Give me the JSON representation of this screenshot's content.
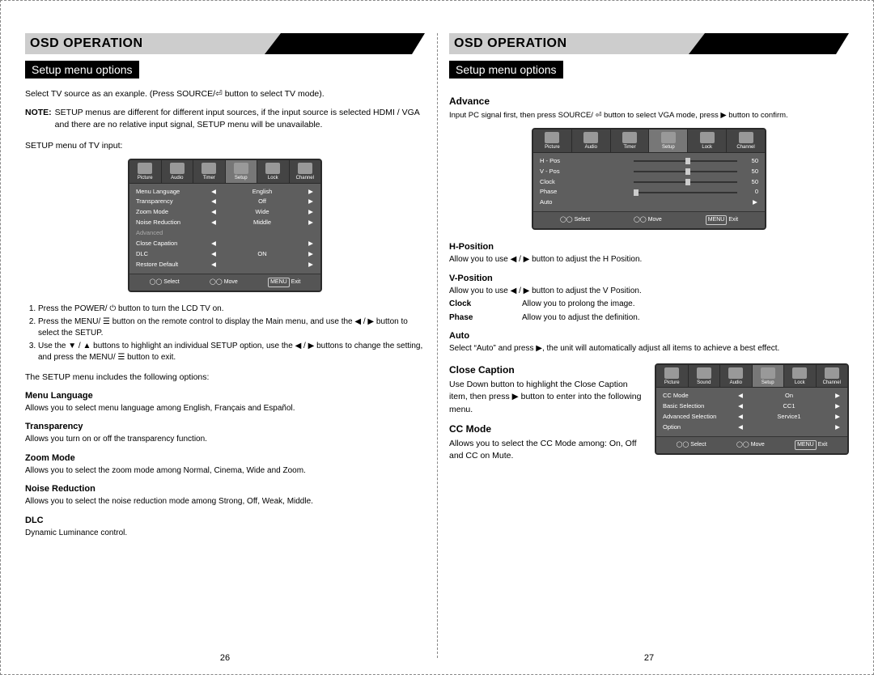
{
  "banner_title": "OSD OPERATION",
  "subtitle": "Setup menu options",
  "left": {
    "intro": "Select TV source as an exanple. (Press SOURCE/⏎ button to select TV mode).",
    "note_label": "NOTE:",
    "note_text": "SETUP menus are different for different input sources, if the input source is selected HDMI / VGA and there are no relative input signal, SETUP menu will be unavailable.",
    "caption": "SETUP menu of TV input:",
    "osd1": {
      "tabs": [
        "Picture",
        "Audio",
        "Timer",
        "Setup",
        "Lock",
        "Channel"
      ],
      "rows": [
        {
          "label": "Menu Language",
          "value": "English"
        },
        {
          "label": "Transparency",
          "value": "Off"
        },
        {
          "label": "Zoom Mode",
          "value": "Wide"
        },
        {
          "label": "Noise Reduction",
          "value": "Middle"
        },
        {
          "label": "Advanced",
          "muted": true
        },
        {
          "label": "Close Capation",
          "value": ""
        },
        {
          "label": "DLC",
          "value": "ON"
        },
        {
          "label": "Restore Default",
          "value": ""
        }
      ],
      "foot": {
        "a": "Select",
        "b": "Move",
        "c": "Exit",
        "c_btn": "MENU"
      }
    },
    "steps": [
      "Press the POWER/ ⏻ button to turn the LCD TV on.",
      "Press the MENU/ ☰ button on the remote control to display the Main menu, and use the ◀ / ▶ button to select the SETUP.",
      "Use the ▼ / ▲ buttons to highlight an individual SETUP option, use the ◀ / ▶ buttons to change the setting, and press the MENU/ ☰ button to exit."
    ],
    "includes": "The SETUP menu includes the following options:",
    "options": [
      {
        "h": "Menu Language",
        "d": "Allows you to select menu language among English, Français and Español."
      },
      {
        "h": "Transparency",
        "d": "Allows you turn on or off the transparency function."
      },
      {
        "h": "Zoom Mode",
        "d": "Allows you to select the zoom mode among Normal, Cinema, Wide and Zoom."
      },
      {
        "h": "Noise Reduction",
        "d": "Allows you to select the noise reduction mode among Strong, Off, Weak, Middle."
      },
      {
        "h": "DLC",
        "d": "Dynamic Luminance control."
      }
    ],
    "page_num": "26"
  },
  "right": {
    "advance_h": "Advance",
    "advance_intro": "Input PC signal first, then press SOURCE/ ⏎ button to select VGA mode, press ▶ button to confirm.",
    "osd2": {
      "tabs": [
        "Picture",
        "Audio",
        "Timer",
        "Setup",
        "Lock",
        "Channel"
      ],
      "rows": [
        {
          "label": "H - Pos",
          "num": "50",
          "p": "50%"
        },
        {
          "label": "V - Pos",
          "num": "50",
          "p": "50%"
        },
        {
          "label": "Clock",
          "num": "50",
          "p": "50%"
        },
        {
          "label": "Phase",
          "num": "0",
          "p": "0%"
        },
        {
          "label": "Auto",
          "arrow": true
        }
      ],
      "foot": {
        "a": "Select",
        "b": "Move",
        "c": "Exit",
        "c_btn": "MENU"
      }
    },
    "defs": {
      "hpos_h": "H-Position",
      "hpos_d": "Allow you to use ◀ / ▶ button to adjust the H Position.",
      "vpos_h": "V-Position",
      "vpos_d": "Allow you to use ◀ / ▶ button to adjust the V Position.",
      "clock_k": "Clock",
      "clock_v": "Allow you to prolong the image.",
      "phase_k": "Phase",
      "phase_v": "Allow you to adjust the definition.",
      "auto_h": "Auto",
      "auto_d": "Select “Auto” and press ▶, the unit will automatically adjust all items to achieve a best effect."
    },
    "cc_h": "Close Caption",
    "cc_d": "Use Down button to highlight the Close Caption item, then press ▶ button to enter into the following menu.",
    "ccmode_h": "CC Mode",
    "ccmode_d": "Allows you to select the CC Mode among: On, Off and CC on Mute.",
    "osd3": {
      "tabs": [
        "Picture",
        "Sound",
        "Audio",
        "Setup",
        "Lock",
        "Channel"
      ],
      "rows": [
        {
          "label": "CC Mode",
          "value": "On"
        },
        {
          "label": "Basic Selection",
          "value": "CC1"
        },
        {
          "label": "Advanced Selection",
          "value": "Service1"
        },
        {
          "label": "Option",
          "value": ""
        }
      ],
      "foot": {
        "a": "Select",
        "b": "Move",
        "c": "Exit",
        "c_btn": "MENU"
      }
    },
    "page_num": "27"
  }
}
